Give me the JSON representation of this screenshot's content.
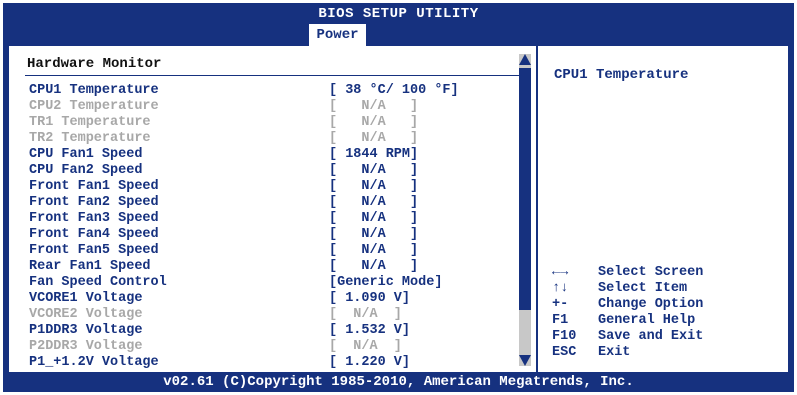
{
  "app": {
    "title": "BIOS SETUP UTILITY"
  },
  "tabs": [
    {
      "label": "Power",
      "active": true
    }
  ],
  "section": {
    "title": "Hardware Monitor"
  },
  "rows": [
    {
      "label": "CPU1 Temperature",
      "value": "[ 38 °C/ 100 °F]",
      "state": "active"
    },
    {
      "label": "CPU2 Temperature",
      "value": "[   N/A   ]",
      "state": "disabled"
    },
    {
      "label": "TR1 Temperature",
      "value": "[   N/A   ]",
      "state": "disabled"
    },
    {
      "label": "TR2 Temperature",
      "value": "[   N/A   ]",
      "state": "disabled"
    },
    {
      "label": "CPU Fan1 Speed",
      "value": "[ 1844 RPM]",
      "state": "active"
    },
    {
      "label": "CPU Fan2 Speed",
      "value": "[   N/A   ]",
      "state": "active"
    },
    {
      "label": "Front Fan1 Speed",
      "value": "[   N/A   ]",
      "state": "active"
    },
    {
      "label": "Front Fan2 Speed",
      "value": "[   N/A   ]",
      "state": "active"
    },
    {
      "label": "Front Fan3 Speed",
      "value": "[   N/A   ]",
      "state": "active"
    },
    {
      "label": "Front Fan4 Speed",
      "value": "[   N/A   ]",
      "state": "active"
    },
    {
      "label": "Front Fan5 Speed",
      "value": "[   N/A   ]",
      "state": "active"
    },
    {
      "label": "Rear Fan1 Speed",
      "value": "[   N/A   ]",
      "state": "active"
    },
    {
      "label": "Fan Speed Control",
      "value": "[Generic Mode]",
      "state": "active"
    },
    {
      "label": "VCORE1 Voltage",
      "value": "[ 1.090 V]",
      "state": "active"
    },
    {
      "label": "VCORE2 Voltage",
      "value": "[  N/A  ]",
      "state": "disabled"
    },
    {
      "label": "P1DDR3 Voltage",
      "value": "[ 1.532 V]",
      "state": "active"
    },
    {
      "label": "P2DDR3 Voltage",
      "value": "[  N/A  ]",
      "state": "disabled"
    },
    {
      "label": "P1_+1.2V Voltage",
      "value": "[ 1.220 V]",
      "state": "active"
    }
  ],
  "help": {
    "title": "CPU1 Temperature",
    "keys": [
      {
        "key": "←→",
        "desc": "Select Screen"
      },
      {
        "key": "↑↓",
        "desc": "Select Item"
      },
      {
        "key": "+-",
        "desc": "Change Option"
      },
      {
        "key": "F1",
        "desc": "General Help"
      },
      {
        "key": "F10",
        "desc": "Save and Exit"
      },
      {
        "key": "ESC",
        "desc": "Exit"
      }
    ]
  },
  "footer": {
    "copyright": "v02.61 (C)Copyright 1985-2010, American Megatrends, Inc."
  },
  "colors": {
    "frame": "#16317f",
    "text": "#16317f",
    "disabled": "#a8a8a8",
    "panel": "#ffffff"
  },
  "icons": {
    "scroll_up": "scroll-up-arrow-icon",
    "scroll_down": "scroll-down-arrow-icon"
  }
}
